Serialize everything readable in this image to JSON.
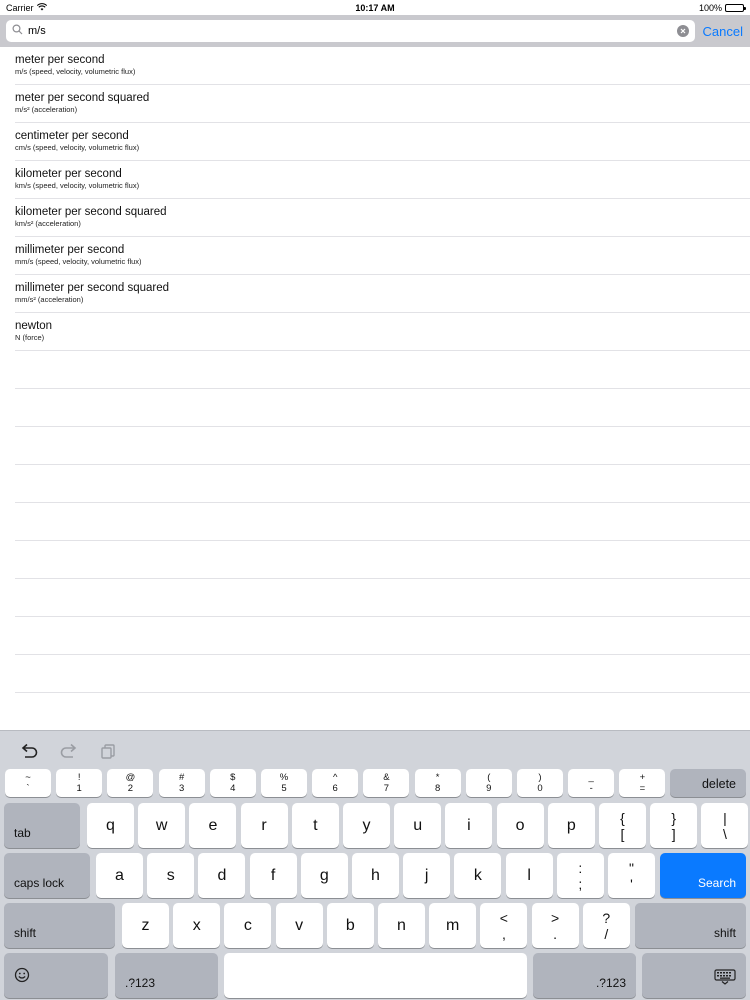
{
  "status": {
    "carrier": "Carrier",
    "time": "10:17 AM",
    "battery": "100%"
  },
  "search": {
    "value": "m/s",
    "cancel": "Cancel"
  },
  "results": [
    {
      "title": "meter per second",
      "subtitle": "m/s (speed, velocity, volumetric flux)"
    },
    {
      "title": "meter per second squared",
      "subtitle": "m/s² (acceleration)"
    },
    {
      "title": "centimeter per second",
      "subtitle": "cm/s (speed, velocity, volumetric flux)"
    },
    {
      "title": "kilometer per second",
      "subtitle": "km/s (speed, velocity, volumetric flux)"
    },
    {
      "title": "kilometer per second squared",
      "subtitle": "km/s² (acceleration)"
    },
    {
      "title": "millimeter per second",
      "subtitle": "mm/s (speed, velocity, volumetric flux)"
    },
    {
      "title": "millimeter per second squared",
      "subtitle": "mm/s² (acceleration)"
    },
    {
      "title": "newton",
      "subtitle": "N (force)"
    }
  ],
  "keyboard": {
    "tools": [
      "undo-icon",
      "redo-icon",
      "paste-icon"
    ],
    "number_row": [
      {
        "top": "~",
        "bottom": "`"
      },
      {
        "top": "!",
        "bottom": "1"
      },
      {
        "top": "@",
        "bottom": "2"
      },
      {
        "top": "#",
        "bottom": "3"
      },
      {
        "top": "$",
        "bottom": "4"
      },
      {
        "top": "%",
        "bottom": "5"
      },
      {
        "top": "^",
        "bottom": "6"
      },
      {
        "top": "&",
        "bottom": "7"
      },
      {
        "top": "*",
        "bottom": "8"
      },
      {
        "top": "(",
        "bottom": "9"
      },
      {
        "top": ")",
        "bottom": "0"
      },
      {
        "top": "_",
        "bottom": "-"
      },
      {
        "top": "+",
        "bottom": "="
      }
    ],
    "delete": "delete",
    "tab": "tab",
    "row1": [
      "q",
      "w",
      "e",
      "r",
      "t",
      "y",
      "u",
      "i",
      "o",
      "p"
    ],
    "row1_extra": [
      {
        "top": "{",
        "bottom": "["
      },
      {
        "top": "}",
        "bottom": "]"
      },
      {
        "top": "|",
        "bottom": "\\"
      }
    ],
    "caps": "caps lock",
    "row2": [
      "a",
      "s",
      "d",
      "f",
      "g",
      "h",
      "j",
      "k",
      "l"
    ],
    "row2_extra": [
      {
        "top": ":",
        "bottom": ";"
      },
      {
        "top": "\"",
        "bottom": "'"
      }
    ],
    "search": "Search",
    "shift": "shift",
    "row3": [
      "z",
      "x",
      "c",
      "v",
      "b",
      "n",
      "m"
    ],
    "row3_extra": [
      {
        "top": "<",
        "bottom": ","
      },
      {
        "top": ">",
        "bottom": "."
      },
      {
        "top": "?",
        "bottom": "/"
      }
    ],
    "numbers": ".?123",
    "emoji": "emoji-icon",
    "dismiss": "keyboard-dismiss-icon"
  },
  "colors": {
    "accent": "#0a7aff",
    "search_bar_bg": "#c9c9ce",
    "keyboard_bg": "#d1d4da"
  }
}
